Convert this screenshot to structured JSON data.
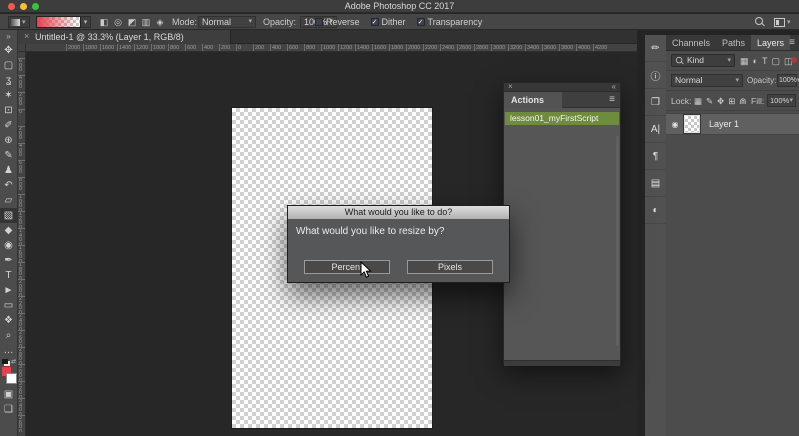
{
  "window": {
    "title": "Adobe Photoshop CC 2017"
  },
  "icons": {
    "caret": "▾",
    "menu": "≡",
    "collapse_right": "»",
    "collapse_left": "«",
    "close": "×",
    "swap": "⇄"
  },
  "colors": {
    "accent_action_green": "#6f8c3e",
    "foreground_swatch": "#e0434d",
    "background_swatch": "#ffffff",
    "gradient_start": "#e0434d",
    "panel_bg": "#4c4c4c",
    "canvas_bg": "#272727"
  },
  "options_bar": {
    "gradient_types": [
      {
        "name": "linear-gradient-button",
        "glyph": "◧"
      },
      {
        "name": "radial-gradient-button",
        "glyph": "◎"
      },
      {
        "name": "angle-gradient-button",
        "glyph": "◩"
      },
      {
        "name": "reflected-gradient-button",
        "glyph": "▥"
      },
      {
        "name": "diamond-gradient-button",
        "glyph": "◈"
      }
    ],
    "mode_label": "Mode:",
    "mode_value": "Normal",
    "opacity_label": "Opacity:",
    "opacity_value": "100%",
    "checkboxes": [
      {
        "name": "reverse-checkbox",
        "label": "Reverse",
        "mark": ""
      },
      {
        "name": "dither-checkbox",
        "label": "Dither",
        "mark": "✓"
      },
      {
        "name": "transparency-checkbox",
        "label": "Transparency",
        "mark": "✓"
      }
    ]
  },
  "document_tab": {
    "title": "Untitled-1 @ 33.3% (Layer 1, RGB/8)"
  },
  "rulers": {
    "horizontal": [
      "2000",
      "1800",
      "1600",
      "1400",
      "1200",
      "1000",
      "800",
      "600",
      "400",
      "200",
      "0",
      "200",
      "400",
      "600",
      "800",
      "1000",
      "1200",
      "1400",
      "1600",
      "1800",
      "2000",
      "2200",
      "2400",
      "2600",
      "2800",
      "3000",
      "3200",
      "3400",
      "3600",
      "3800",
      "4000",
      "4200"
    ],
    "vertical": [
      "600",
      "400",
      "200",
      "0",
      "200",
      "400",
      "600",
      "800",
      "1000",
      "1200",
      "1400",
      "1600",
      "1800",
      "2000",
      "2200",
      "2400",
      "2600",
      "2800",
      "3000",
      "3200",
      "3400",
      "3600"
    ]
  },
  "toolbar": {
    "tools_upper": [
      {
        "name": "move-tool",
        "glyph": "✥"
      },
      {
        "name": "rectangular-marquee-tool",
        "glyph": "▢"
      },
      {
        "name": "lasso-tool",
        "glyph": "ʓ"
      },
      {
        "name": "magic-wand-tool",
        "glyph": "✶"
      },
      {
        "name": "crop-tool",
        "glyph": "⊡"
      },
      {
        "name": "eyedropper-tool",
        "glyph": "✐"
      },
      {
        "name": "healing-brush-tool",
        "glyph": "⊕"
      },
      {
        "name": "brush-tool",
        "glyph": "✎"
      },
      {
        "name": "clone-stamp-tool",
        "glyph": "♟"
      },
      {
        "name": "history-brush-tool",
        "glyph": "↶"
      },
      {
        "name": "eraser-tool",
        "glyph": "▱"
      }
    ],
    "gradient_tool": {
      "label": "▧"
    },
    "tools_lower": [
      {
        "name": "blur-tool",
        "glyph": "◆"
      },
      {
        "name": "dodge-tool",
        "glyph": "◉"
      },
      {
        "name": "pen-tool",
        "glyph": "✒"
      },
      {
        "name": "type-tool",
        "glyph": "T"
      },
      {
        "name": "path-selection-tool",
        "glyph": "►"
      },
      {
        "name": "shape-tool",
        "glyph": "▭"
      },
      {
        "name": "hand-tool",
        "glyph": "❖"
      },
      {
        "name": "zoom-tool",
        "glyph": "⌕"
      },
      {
        "name": "edit-toolbar-button",
        "glyph": "…"
      }
    ],
    "quick_mask_glyph": "▣",
    "screen_mode_glyph": "❑"
  },
  "actions_panel": {
    "tab_label": "Actions",
    "items": [
      {
        "name": "action-item-lesson01",
        "label": "lesson01_myFirstScript"
      }
    ]
  },
  "dialog": {
    "title": "What would you like to do?",
    "message": "What would you like to resize by?",
    "buttons": [
      {
        "name": "percent-button",
        "label": "Percent"
      },
      {
        "name": "pixels-button",
        "label": "Pixels"
      }
    ]
  },
  "dock": {
    "collapsed_icons": [
      {
        "name": "brush-settings-panel-icon",
        "glyph": "✏"
      },
      {
        "name": "info-panel-icon",
        "glyph": "ⓘ"
      },
      {
        "name": "clone-source-panel-icon",
        "glyph": "❐"
      },
      {
        "name": "character-panel-icon",
        "glyph": "A|"
      },
      {
        "name": "paragraph-panel-icon",
        "glyph": "¶"
      },
      {
        "name": "layer-comps-panel-icon",
        "glyph": "▤"
      },
      {
        "name": "adjustments-panel-icon",
        "glyph": "◐"
      }
    ],
    "tabs": [
      {
        "label": "Channels"
      },
      {
        "label": "Paths"
      },
      {
        "label": "Layers"
      }
    ],
    "kind_label": "Kind",
    "filter_icons": [
      {
        "name": "filter-pixel-layers-icon",
        "glyph": "▦"
      },
      {
        "name": "filter-adjustment-layers-icon",
        "glyph": "◐"
      },
      {
        "name": "filter-type-layers-icon",
        "glyph": "T"
      },
      {
        "name": "filter-shape-layers-icon",
        "glyph": "▢"
      },
      {
        "name": "filter-smart-objects-icon",
        "glyph": "◫"
      }
    ],
    "blend_mode": "Normal",
    "opacity_label": "Opacity:",
    "opacity_value": "100%",
    "lock_label": "Lock:",
    "lock_icons": [
      {
        "name": "lock-transparency-icon",
        "glyph": "▦"
      },
      {
        "name": "lock-image-icon",
        "glyph": "✎"
      },
      {
        "name": "lock-position-icon",
        "glyph": "✥"
      },
      {
        "name": "lock-artboard-icon",
        "glyph": "⊞"
      },
      {
        "name": "lock-all-icon",
        "glyph": "⋒"
      }
    ],
    "fill_label": "Fill:",
    "fill_value": "100%",
    "layer": {
      "visibility_glyph": "◉",
      "name": "Layer 1"
    }
  }
}
